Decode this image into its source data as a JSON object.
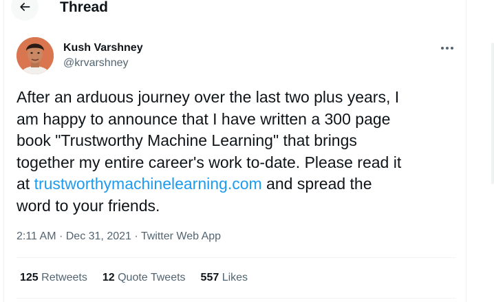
{
  "header": {
    "title": "Thread"
  },
  "tweet": {
    "author_name": "Kush Varshney",
    "author_handle": "@krvarshney",
    "text_lines": [
      "After an arduous journey over the last two plus years, I",
      "am happy to announce that I have written a 300 page",
      "book \"Trustworthy Machine Learning\" that brings",
      "together my entire career's work to-date. Please read it"
    ],
    "line5_prefix": "at ",
    "link_text": "trustworthymachinelearning.com",
    "line5_suffix": " and spread the",
    "line6": "word to your friends.",
    "time": "2:11 AM",
    "sep1": " · ",
    "date": "Dec 31, 2021",
    "sep2": " · ",
    "source": "Twitter Web App"
  },
  "stats": {
    "retweets_count": "125",
    "retweets_label": "Retweets",
    "quotes_count": "12",
    "quotes_label": "Quote Tweets",
    "likes_count": "557",
    "likes_label": "Likes"
  },
  "icons": {
    "back": "arrow-left-icon",
    "more": "more-horizontal-icon"
  },
  "colors": {
    "link": "#1d9bf0",
    "secondary_text": "#536471",
    "primary_text": "#0f1419",
    "divider": "#eff3f4"
  }
}
